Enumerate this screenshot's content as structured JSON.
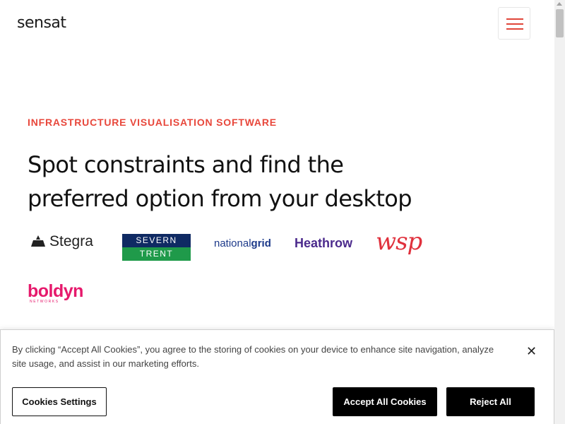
{
  "header": {
    "logo_text": "sensat",
    "menu_icon": "hamburger-menu-icon",
    "accent_color": "#e0463a"
  },
  "hero": {
    "eyebrow": "INFRASTRUCTURE VISUALISATION SOFTWARE",
    "headline": "Spot constraints and find the preferred option from your desktop"
  },
  "client_logos": {
    "stegra": "Stegra",
    "severn_top": "SEVERN",
    "severn_bottom": "TRENT",
    "national_grid_1": "national",
    "national_grid_2": "grid",
    "heathrow": "Heathrow",
    "wsp": "wsp",
    "boldyn": "boldyn",
    "boldyn_sub": "NETWORKS"
  },
  "cookie_banner": {
    "message": "By clicking “Accept All Cookies”, you agree to the storing of cookies on your device to enhance site navigation, analyze site usage, and assist in our marketing efforts.",
    "close_icon": "close-icon",
    "close_glyph": "✕",
    "settings_label": "Cookies Settings",
    "accept_label": "Accept All Cookies",
    "reject_label": "Reject All"
  }
}
